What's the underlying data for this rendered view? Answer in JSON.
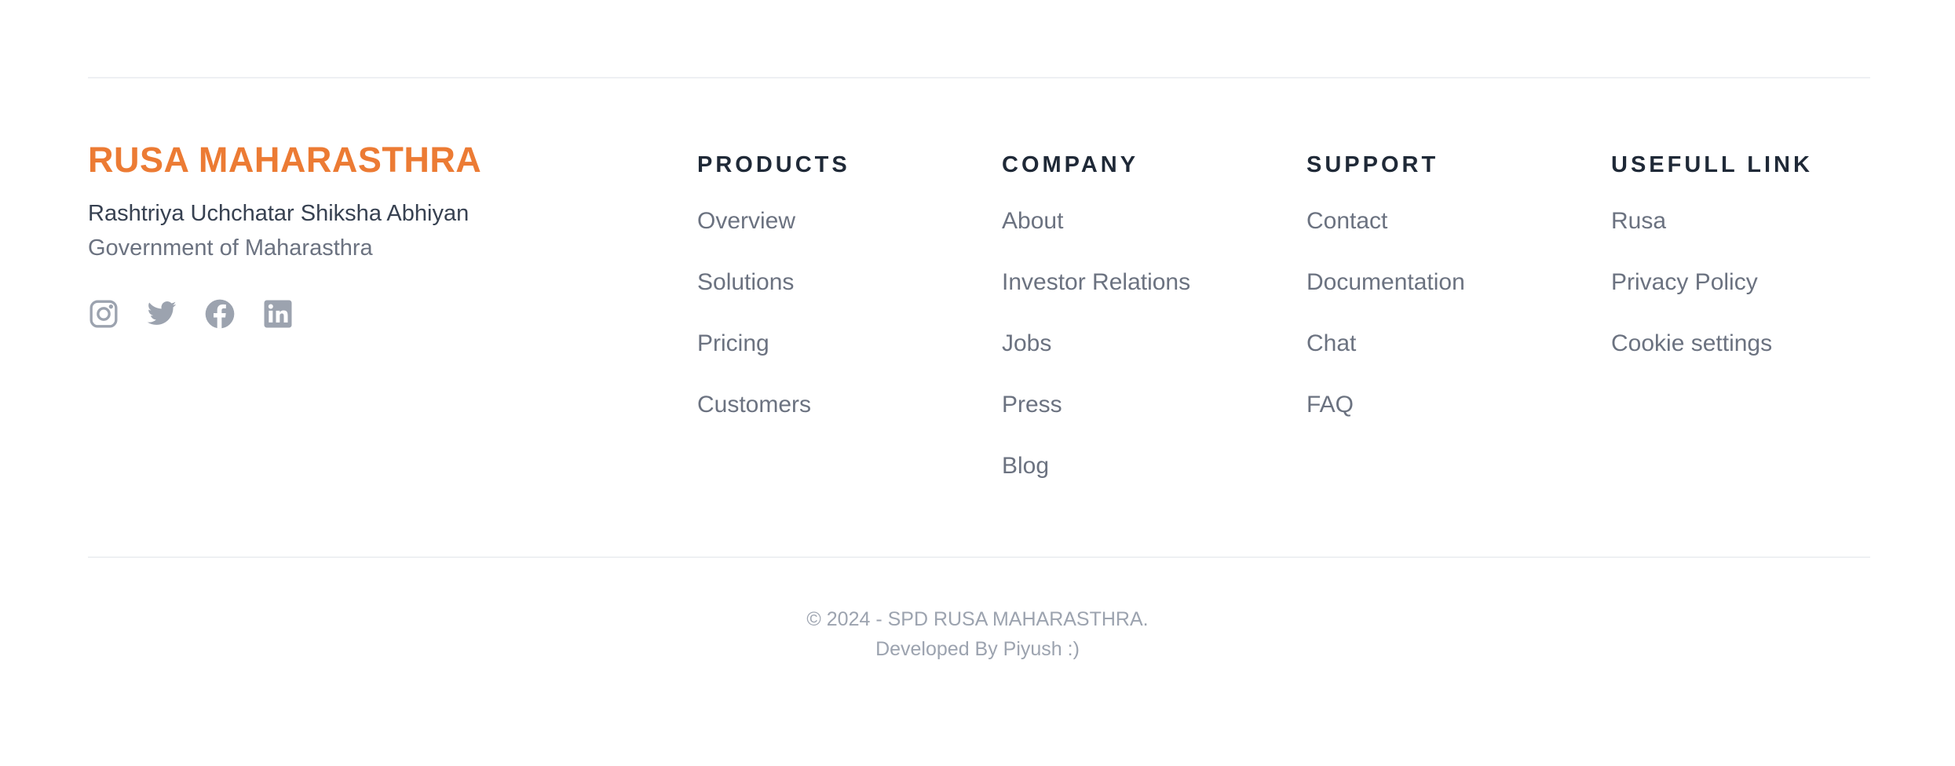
{
  "brand": {
    "title": "RUSA MAHARASTHRA",
    "subtitle": "Rashtriya Uchchatar Shiksha Abhiyan",
    "government": "Government of Maharasthra",
    "accent_color": "#ec7b34"
  },
  "socials": [
    {
      "icon": "instagram-icon"
    },
    {
      "icon": "twitter-icon"
    },
    {
      "icon": "facebook-icon"
    },
    {
      "icon": "linkedin-icon"
    }
  ],
  "columns": [
    {
      "heading": "PRODUCTS",
      "links": [
        "Overview",
        "Solutions",
        "Pricing",
        "Customers"
      ]
    },
    {
      "heading": "COMPANY",
      "links": [
        "About",
        "Investor Relations",
        "Jobs",
        "Press",
        "Blog"
      ]
    },
    {
      "heading": "SUPPORT",
      "links": [
        "Contact",
        "Documentation",
        "Chat",
        "FAQ"
      ]
    },
    {
      "heading": "USEFULL LINK",
      "links": [
        "Rusa",
        "Privacy Policy",
        "Cookie settings"
      ]
    }
  ],
  "copyright": {
    "line1": "© 2024 - SPD RUSA MAHARASTHRA.",
    "line2": "Developed By Piyush :)"
  }
}
